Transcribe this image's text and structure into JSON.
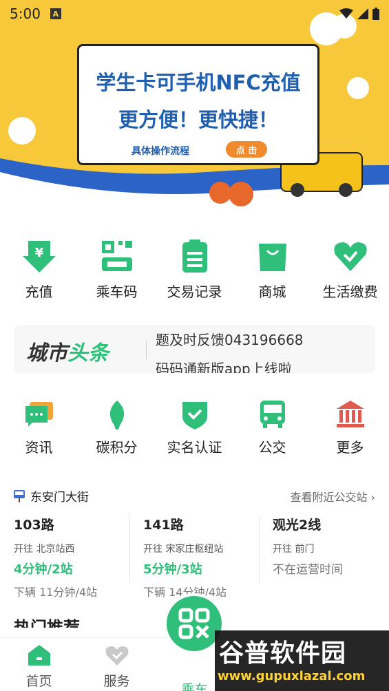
{
  "status_bar": {
    "time": "5:00"
  },
  "banner": {
    "headline": "学生卡可手机NFC充值",
    "subline": "更方便！更快捷！",
    "procedure_label": "具体操作流程",
    "click_label": "点 击"
  },
  "quick_actions": [
    {
      "label": "充值",
      "icon": "yuan-down-icon"
    },
    {
      "label": "乘车码",
      "icon": "qr-ticket-icon"
    },
    {
      "label": "交易记录",
      "icon": "clipboard-icon"
    },
    {
      "label": "商城",
      "icon": "shopping-bag-icon"
    },
    {
      "label": "生活缴费",
      "icon": "heart-icon"
    }
  ],
  "news": {
    "logo_part1": "城市",
    "logo_part2": "头条",
    "line1": "题及时反馈043196668",
    "line2": "码码通新版app上线啦"
  },
  "services": [
    {
      "label": "资讯",
      "icon": "chat-icon"
    },
    {
      "label": "碳积分",
      "icon": "leaf-icon"
    },
    {
      "label": "实名认证",
      "icon": "shield-check-icon"
    },
    {
      "label": "公交",
      "icon": "bus-icon"
    },
    {
      "label": "更多",
      "icon": "bank-icon"
    }
  ],
  "bus": {
    "stop_name": "东安门大街",
    "nearby_link": "查看附近公交站 ›",
    "routes": [
      {
        "name": "103路",
        "direction": "开往 北京站西",
        "eta": "4分钟/2站",
        "next": "下辆 11分钟/4站"
      },
      {
        "name": "141路",
        "direction": "开往 宋家庄枢纽站",
        "eta": "5分钟/3站",
        "next": "下辆 14分钟/4站"
      },
      {
        "name": "观光2线",
        "direction": "开往 前门",
        "eta": "不在运营时间",
        "next": ""
      }
    ]
  },
  "hot_section_title": "热门推荐",
  "tabbar": [
    {
      "label": "首页",
      "icon": "home-icon"
    },
    {
      "label": "服务",
      "icon": "heart-icon"
    },
    {
      "label": "乘车",
      "icon": "qr-code-icon"
    }
  ],
  "watermark": {
    "line1": "谷普软件园",
    "line2": "www.gupuxlazal.com"
  },
  "colors": {
    "accent": "#2fbf7a",
    "banner_bg": "#f7c83a",
    "headline": "#1f5fae",
    "more_red": "#e05a4f"
  }
}
